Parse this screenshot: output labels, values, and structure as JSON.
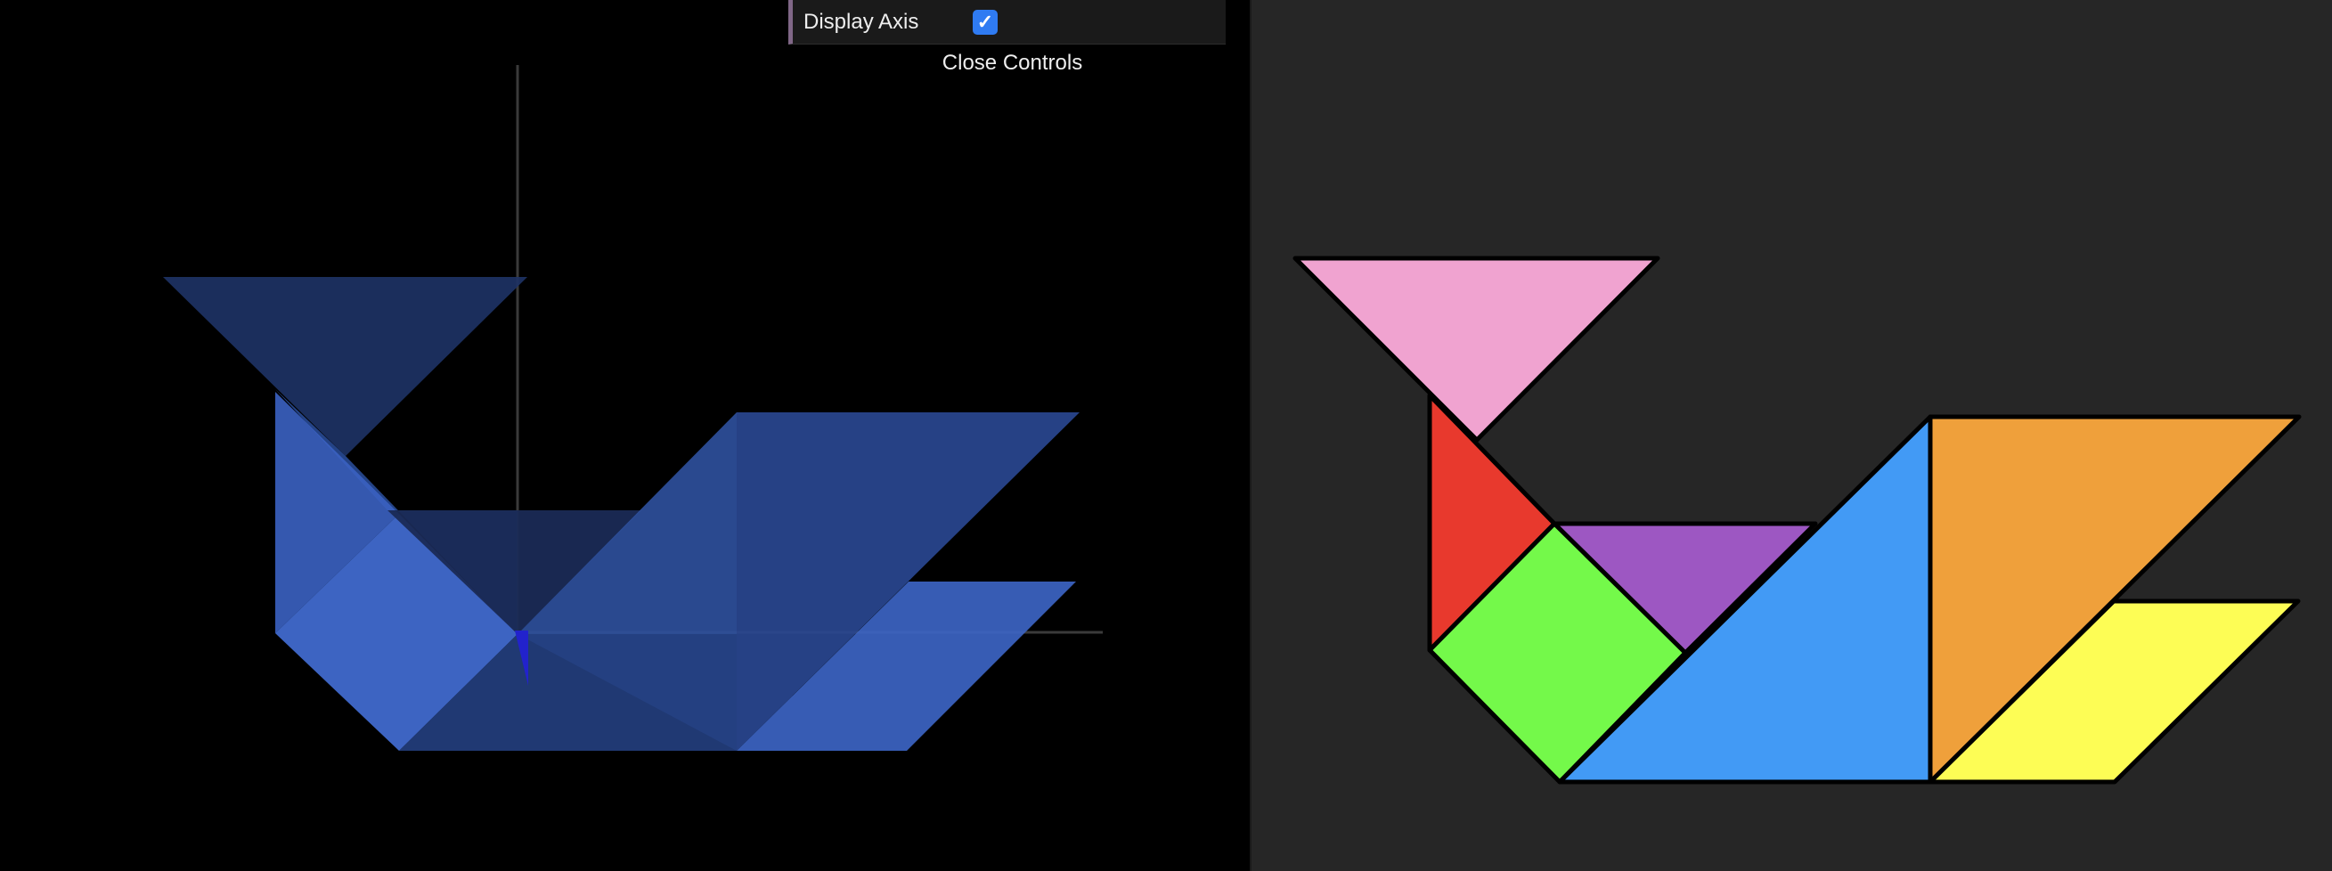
{
  "controls": {
    "display_axis_label": "Display Axis",
    "display_axis_checked": true,
    "close_label": "Close Controls"
  },
  "colors": {
    "scene_background": "#000000",
    "canvas_background": "#262626",
    "tan_blue_3d": "#3c64c8",
    "pink": "#f0a3d0",
    "red": "#e8392d",
    "purple": "#9d57c2",
    "green": "#74f94a",
    "blue": "#429af5",
    "orange": "#efa03b",
    "yellow": "#fdfd55"
  }
}
